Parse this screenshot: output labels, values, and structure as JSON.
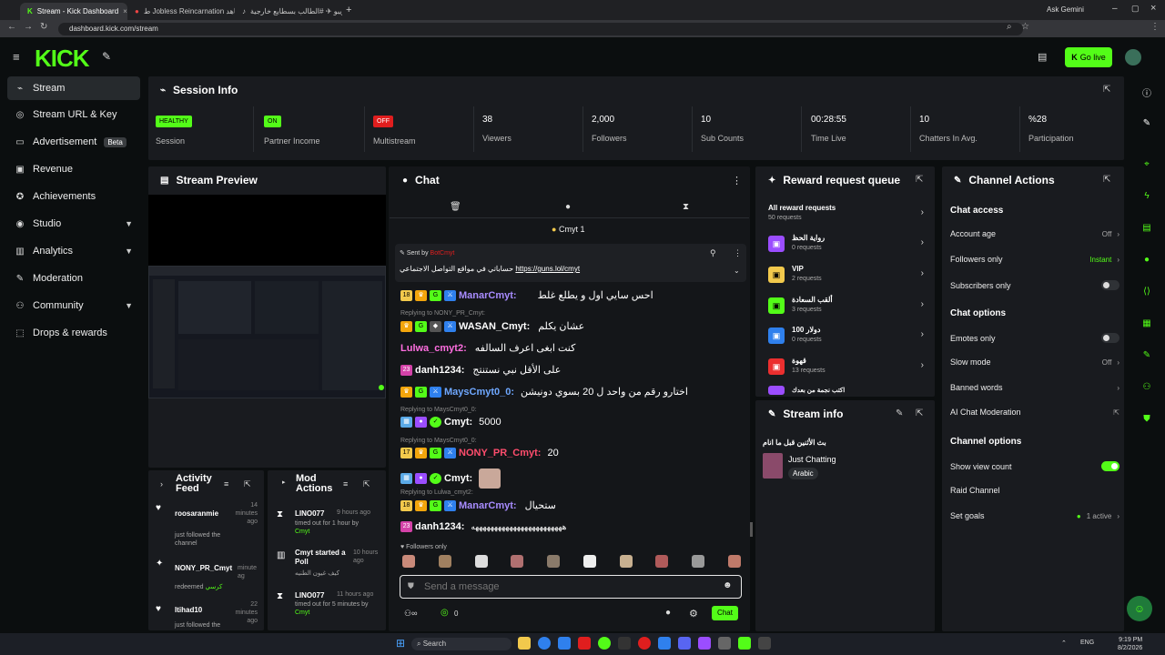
{
  "browser": {
    "tabs": [
      {
        "label": "Stream - Kick Dashboard",
        "close": "×"
      },
      {
        "label": "ط Jobless Reincarnation شاهد",
        "close": "×"
      },
      {
        "label": "ويبو ✈ #الطالب بسطايع خارجية",
        "close": "×"
      }
    ],
    "new_tab": "+",
    "ask_gemini": "Ask Gemini",
    "url": "dashboard.kick.com/stream"
  },
  "header": {
    "logo": "KICK",
    "go_live": "Go live"
  },
  "sidebar": {
    "items": [
      {
        "label": "Stream",
        "icon": "antenna-icon"
      },
      {
        "label": "Stream URL & Key",
        "icon": "globe-icon"
      },
      {
        "label": "Advertisement",
        "icon": "ad-icon",
        "badge": "Beta"
      },
      {
        "label": "Revenue",
        "icon": "wallet-icon"
      },
      {
        "label": "Achievements",
        "icon": "trophy-icon"
      },
      {
        "label": "Studio",
        "icon": "camera-icon"
      },
      {
        "label": "Analytics",
        "icon": "chart-icon"
      },
      {
        "label": "Moderation",
        "icon": "wrench-icon"
      },
      {
        "label": "Community",
        "icon": "community-icon"
      },
      {
        "label": "Drops & rewards",
        "icon": "gift-icon"
      }
    ]
  },
  "session": {
    "title": "Session Info",
    "stats": [
      {
        "value": "HEALTHY",
        "label": "Session"
      },
      {
        "value": "ON",
        "label": "Partner Income"
      },
      {
        "value": "OFF",
        "label": "Multistream"
      },
      {
        "value": "38",
        "label": "Viewers"
      },
      {
        "value": "2,000",
        "label": "Followers"
      },
      {
        "value": "10",
        "label": "Sub Counts"
      },
      {
        "value": "00:28:55",
        "label": "Time Live"
      },
      {
        "value": "10",
        "label": "Chatters In Avg."
      },
      {
        "value": "%28",
        "label": "Participation"
      }
    ]
  },
  "preview": {
    "title": "Stream Preview"
  },
  "activity": {
    "title": "Activity Feed",
    "items": [
      {
        "user": "roosaranmie",
        "time": "14 minutes ago",
        "text": "just followed the channel"
      },
      {
        "user": "NONY_PR_Cmyt",
        "time": "minute ag",
        "text": "redeemed",
        "reward": "كرسي"
      },
      {
        "user": "Itihad10",
        "time": "22 minutes ago",
        "text": "just followed the"
      }
    ]
  },
  "mod": {
    "title": "Mod Actions",
    "items": [
      {
        "user": "LINO077",
        "time": "9 hours ago",
        "text": "timed out for 1 hour by",
        "by": "Cmyt"
      },
      {
        "user": "Cmyt started a Poll",
        "time": "10 hours ago",
        "text": "كيف غيون الطنيه"
      },
      {
        "user": "LINO077",
        "time": "11 hours ago",
        "text": "timed out for 5 minutes by",
        "by": "Cmyt"
      }
    ]
  },
  "chat": {
    "title": "Chat",
    "pinned_by": "Cmyt 1",
    "pinned_label": "Sent by",
    "pinned_user": "BotCmyt",
    "pinned_text": "حساباتي في مواقع التواصل الاجتماعي",
    "pinned_link": "https://guns.lol/cmyt",
    "messages": [
      {
        "badge": "18",
        "user": "ManarCmyt:",
        "color": "#a88cff",
        "text": "احس سايي اول و يطلع غلط"
      },
      {
        "reply": "Replying to NONY_PR_Cmyt:",
        "user": "WASAN_Cmyt:",
        "color": "#ffffff",
        "text": "عشان يكلم"
      },
      {
        "user": "Lulwa_cmyt2:",
        "color": "#ff6ee0",
        "text": "كنت ابغى اعرف السالفه"
      },
      {
        "badge": "23",
        "user": "danh1234:",
        "color": "#ffffff",
        "text": "على الأقل نبي نستنتج"
      },
      {
        "user": "MaysCmyt0_0:",
        "color": "#6fa8ff",
        "text": "اختارو رقم من واحد ل 20 بسوي دونيشن"
      },
      {
        "reply": "Replying to MaysCmyt0_0:",
        "user": "Cmyt:",
        "color": "#ffffff",
        "text": "5000"
      },
      {
        "reply": "Replying to MaysCmyt0_0:",
        "badge": "17",
        "user": "NONY_PR_Cmyt:",
        "color": "#ff4d6d",
        "text": "20"
      },
      {
        "user": "Cmyt:",
        "color": "#ffffff",
        "text": ""
      },
      {
        "reply": "Replying to Lulwa_cmyt2:",
        "badge": "18",
        "user": "ManarCmyt:",
        "color": "#a88cff",
        "text": "ستحيال"
      },
      {
        "badge": "23",
        "user": "danh1234:",
        "color": "#ffffff",
        "text": "ههههههههههههههههههههههههه"
      }
    ],
    "followers_only": "Followers only",
    "placeholder": "Send a message",
    "points": "0",
    "send": "Chat"
  },
  "rewards": {
    "title": "Reward request queue",
    "all": "All reward requests",
    "all_count": "50 requests",
    "items": [
      {
        "name": "رواية الحظ",
        "count": "0 requests",
        "color": "#9b4dff"
      },
      {
        "name": "VIP",
        "count": "2 requests",
        "color": "#f2c94c"
      },
      {
        "name": "ألقب السعادة",
        "count": "3 requests",
        "color": "#53fc18"
      },
      {
        "name": "دولار 100",
        "count": "0 requests",
        "color": "#2f80ed"
      },
      {
        "name": "قهوة",
        "count": "13 requests",
        "color": "#eb2f2f"
      },
      {
        "name": "اكتب نجمة من بعدك",
        "count": "",
        "color": "#9b4dff"
      }
    ]
  },
  "stream_info": {
    "title": "Stream info",
    "stream_title": "بث الأثنين قبل ما انام",
    "category": "Just Chatting",
    "language": "Arabic"
  },
  "channel": {
    "title": "Channel Actions",
    "chat_access": "Chat access",
    "account_age": {
      "label": "Account age",
      "value": "Off"
    },
    "followers_only": {
      "label": "Followers only",
      "value": "Instant"
    },
    "subscribers_only": "Subscribers only",
    "chat_options": "Chat options",
    "emotes_only": "Emotes only",
    "slow_mode": {
      "label": "Slow mode",
      "value": "Off"
    },
    "banned_words": "Banned words",
    "ai_moderation": "AI Chat Moderation",
    "channel_options": "Channel options",
    "show_view_count": "Show view count",
    "raid_channel": "Raid Channel",
    "set_goals": {
      "label": "Set goals",
      "value": "1 active"
    }
  },
  "taskbar": {
    "search": "Search",
    "lang": "ENG",
    "time": "9:19 PM",
    "date": "8/2/2026"
  }
}
